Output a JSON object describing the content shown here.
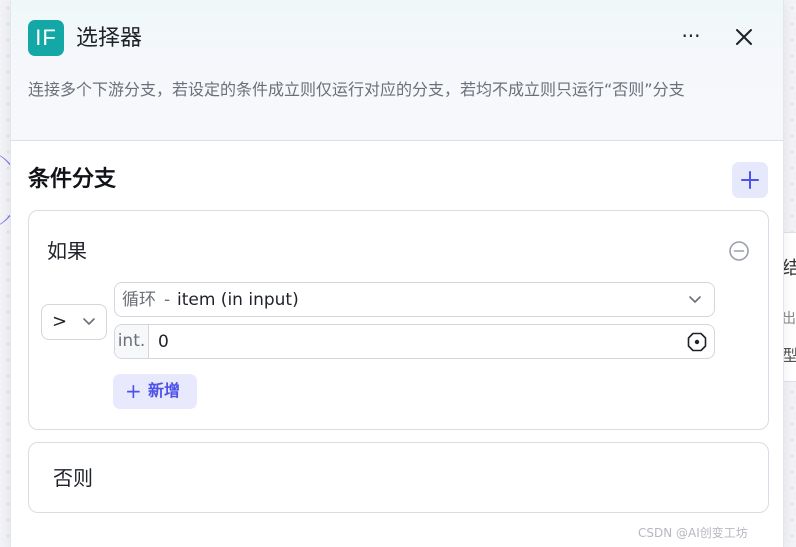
{
  "node": {
    "icon_label": "IF",
    "title": "选择器",
    "description": "连接多个下游分支，若设定的条件成立则仅运行对应的分支，若均不成立则只运行“否则”分支",
    "accent_color": "#13a7a5"
  },
  "header_actions": {
    "more_icon": "more-horizontal-icon",
    "more_glyph": "···",
    "close_icon": "close-icon"
  },
  "section": {
    "title": "条件分支",
    "add_icon": "plus-icon"
  },
  "branches": {
    "if": {
      "label": "如果",
      "operator": ">",
      "variable_prefix": "循环",
      "variable_separator": "-",
      "variable": "item (in input)",
      "value_type": "int.",
      "value": "0",
      "add_condition_label": "新增",
      "add_condition_plus": "+"
    },
    "else": {
      "label": "否则"
    }
  },
  "background": {
    "node_text_1": "结",
    "node_text_2": "出",
    "node_text_3": "型"
  },
  "watermark": "CSDN @AI创变工坊",
  "colors": {
    "primary": "#4d53e8",
    "primary_bg": "#e8e9fc",
    "text": "#1f2329",
    "muted": "#6b7079"
  }
}
